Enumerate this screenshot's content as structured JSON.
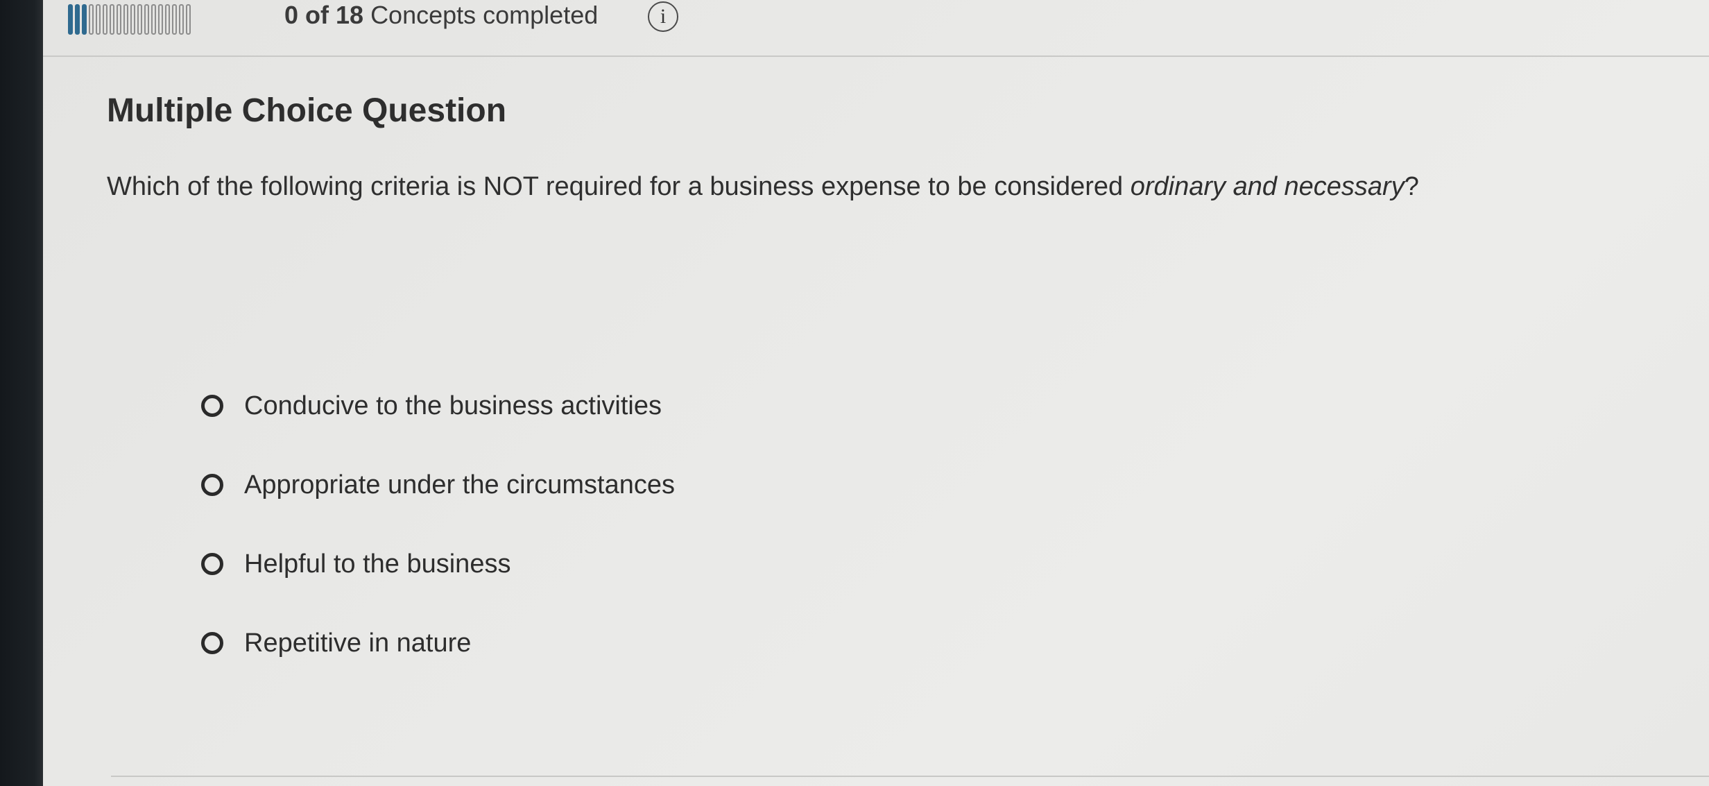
{
  "header": {
    "progress": {
      "completed": 3,
      "total": 18,
      "count_text": "0 of 18",
      "label": "Concepts completed"
    },
    "info_icon_glyph": "i"
  },
  "question": {
    "type_title": "Multiple Choice Question",
    "prompt_before": "Which of the following criteria is NOT required for a business expense to be considered ",
    "prompt_emphasis": "ordinary and necessary",
    "prompt_after": "?",
    "options": [
      {
        "label": "Conducive to the business activities"
      },
      {
        "label": "Appropriate under the circumstances"
      },
      {
        "label": "Helpful to the business"
      },
      {
        "label": "Repetitive in nature"
      }
    ]
  },
  "colors": {
    "accent": "#2f6a8f",
    "progress_empty_border": "#8d8d8d",
    "background": "#e6e6e4"
  },
  "icons": {
    "info": "info-circle-icon",
    "radio": "radio-unselected-icon"
  }
}
